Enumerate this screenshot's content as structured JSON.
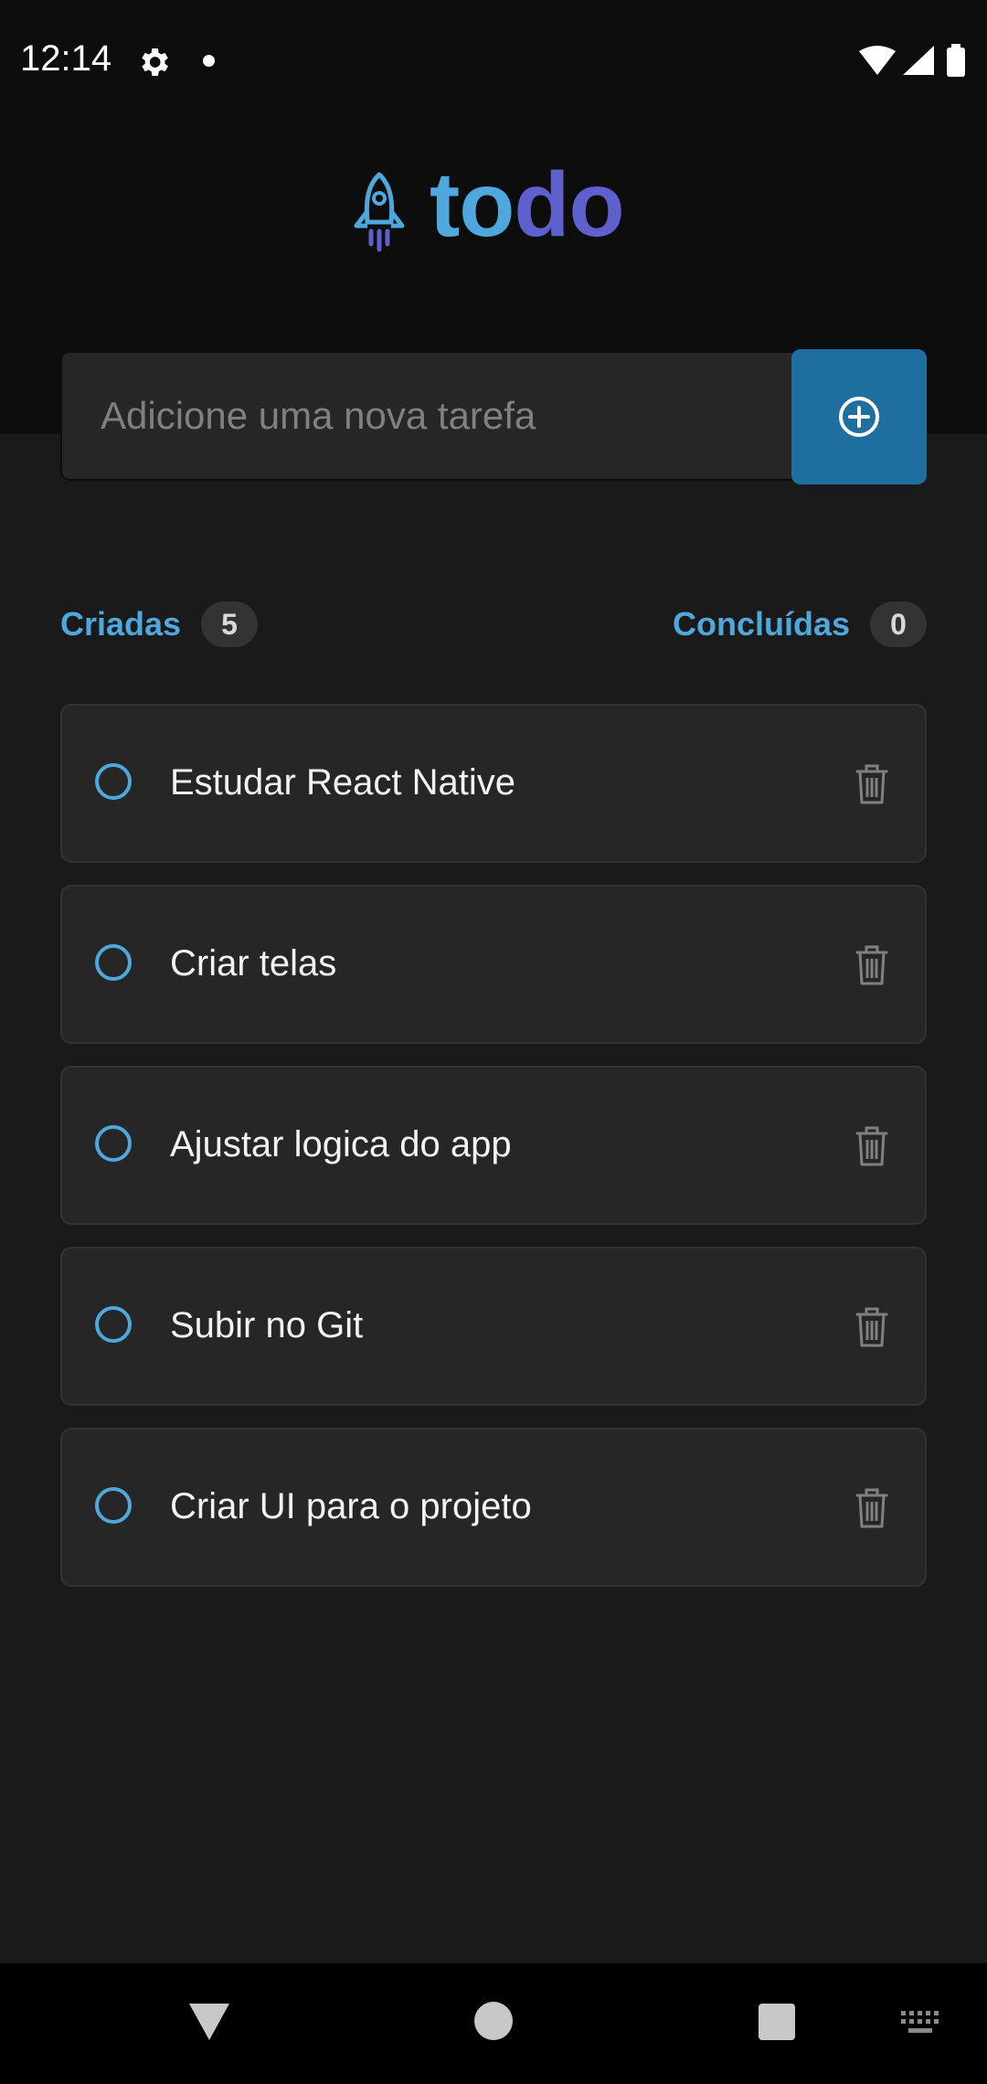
{
  "status_bar": {
    "time": "12:14",
    "icons": [
      "gear-icon",
      "notification-dot",
      "wifi-icon",
      "signal-icon",
      "battery-icon"
    ]
  },
  "app": {
    "logo_part1": "to",
    "logo_part2": "do",
    "logo_icon": "rocket-icon"
  },
  "new_task": {
    "placeholder": "Adicione uma nova tarefa",
    "value": "",
    "add_icon": "plus-circle-icon"
  },
  "counters": {
    "created_label": "Criadas",
    "created_count": "5",
    "done_label": "Concluídas",
    "done_count": "0"
  },
  "tasks": [
    {
      "text": "Estudar React Native",
      "done": false
    },
    {
      "text": "Criar telas",
      "done": false
    },
    {
      "text": "Ajustar logica do app",
      "done": false
    },
    {
      "text": "Subir no Git",
      "done": false
    },
    {
      "text": "Criar UI para o projeto",
      "done": false
    }
  ],
  "colors": {
    "blue": "#4ea8de",
    "purple": "#5e60ce",
    "button": "#1e6f9f",
    "card": "#262626",
    "background": "#1a1a1a"
  }
}
